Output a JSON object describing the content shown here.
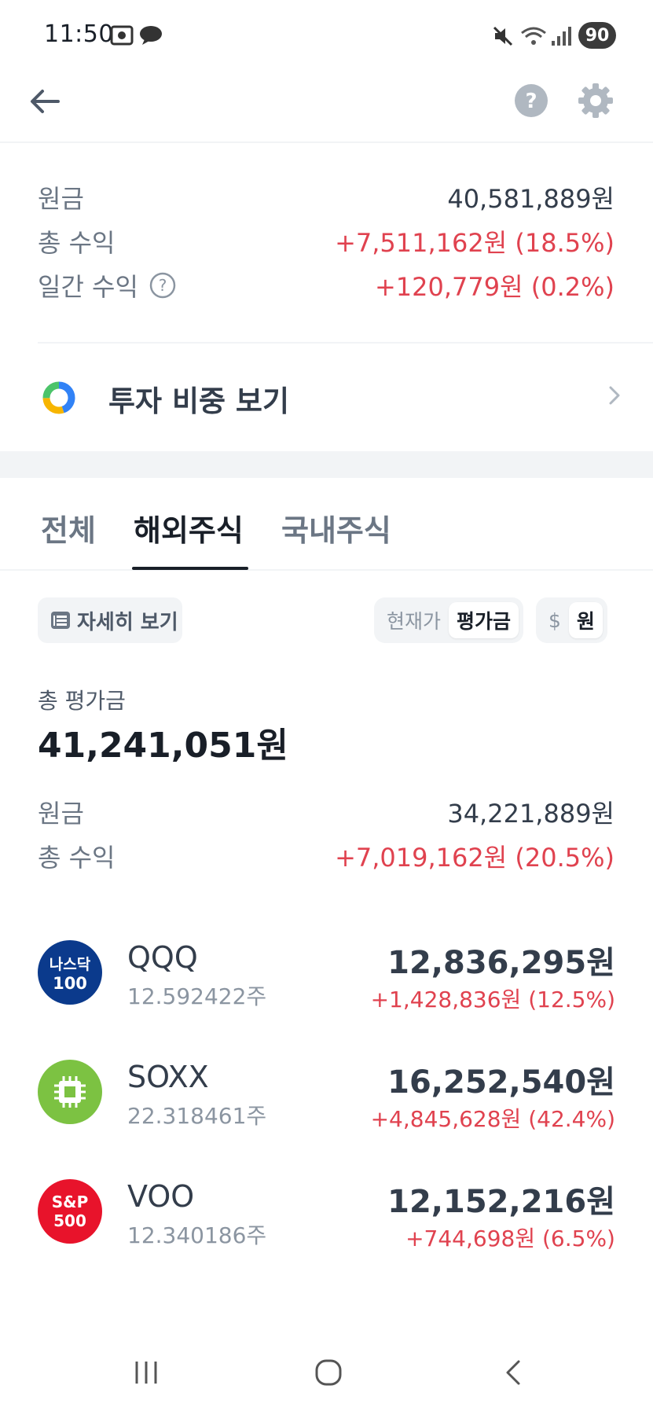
{
  "status": {
    "time": "11:50",
    "battery": "90"
  },
  "summary": {
    "principal_label": "원금",
    "principal_value": "40,581,889원",
    "total_return_label": "총 수익",
    "total_return_value": "+7,511,162원 (18.5%)",
    "daily_return_label": "일간 수익",
    "daily_return_value": "+120,779원 (0.2%)"
  },
  "weight": {
    "label": "투자 비중 보기"
  },
  "tabs": [
    {
      "label": "전체"
    },
    {
      "label": "해외주식"
    },
    {
      "label": "국내주식"
    }
  ],
  "controls": {
    "detail_label": "자세히 보기",
    "price_toggle": {
      "option_current": "현재가",
      "option_valuation": "평가금",
      "selected": "평가금"
    },
    "currency_toggle": {
      "option_usd": "$",
      "option_krw": "원",
      "selected": "원"
    }
  },
  "overseas": {
    "total_label": "총 평가금",
    "total_value": "41,241,051원",
    "principal_label": "원금",
    "principal_value": "34,221,889원",
    "return_label": "총 수익",
    "return_value": "+7,019,162원 (20.5%)"
  },
  "holdings": [
    {
      "ticker": "QQQ",
      "shares": "12.592422주",
      "amount": "12,836,295원",
      "change": "+1,428,836원 (12.5%)",
      "logo_line1": "나스닥",
      "logo_line2": "100",
      "logo_color": "#0b3a8c"
    },
    {
      "ticker": "SOXX",
      "shares": "22.318461주",
      "amount": "16,252,540원",
      "change": "+4,845,628원 (42.4%)",
      "logo_color": "#7cc242",
      "icon": "chip-icon"
    },
    {
      "ticker": "VOO",
      "shares": "12.340186주",
      "amount": "12,152,216원",
      "change": "+744,698원 (6.5%)",
      "logo_line1": "S&P",
      "logo_line2": "500",
      "logo_color": "#e8132b"
    }
  ],
  "colors": {
    "positive": "#e0424f",
    "text_primary": "#191f28",
    "text_secondary": "#6b7684"
  }
}
